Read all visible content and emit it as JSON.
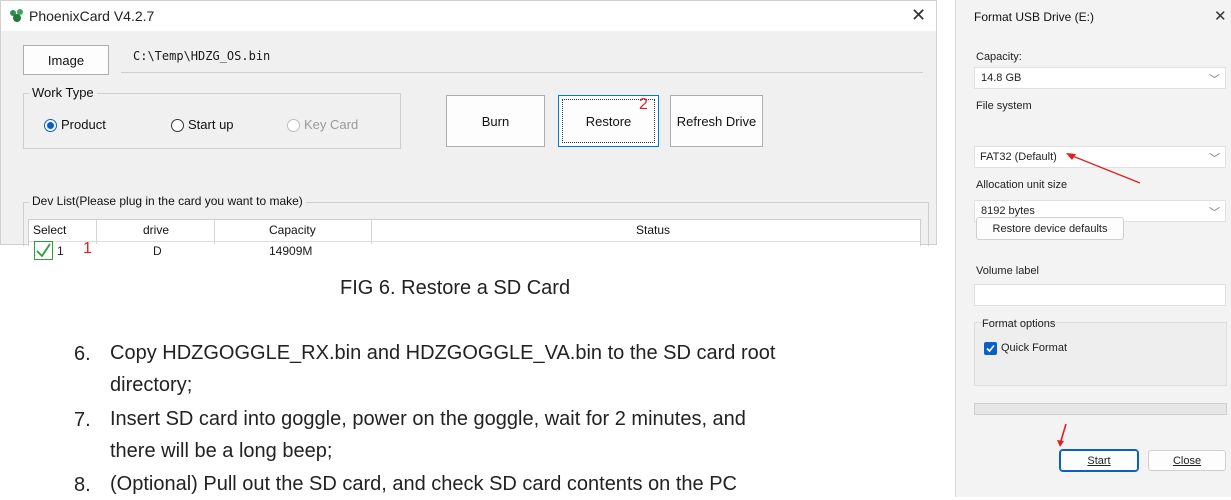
{
  "phoenix": {
    "title": "PhoenixCard V4.2.7",
    "close_glyph": "✕",
    "image_button": "Image",
    "image_path": "C:\\Temp\\HDZG_OS.bin",
    "work_type": {
      "legend": "Work Type",
      "options": [
        "Product",
        "Start up",
        "Key Card"
      ]
    },
    "buttons": {
      "burn": "Burn",
      "restore": "Restore",
      "refresh": "Refresh Drive"
    },
    "dev_list": {
      "legend": "Dev List(Please plug in the card you want to make)",
      "columns": [
        "Select",
        "drive",
        "Capacity",
        "Status"
      ],
      "rows": [
        {
          "index": "1",
          "drive": "D",
          "capacity": "14909M",
          "status": ""
        }
      ]
    },
    "annotations": {
      "restore": "2",
      "row": "1"
    }
  },
  "caption": "FIG 6. Restore a SD Card",
  "steps": [
    {
      "num": "6.",
      "line1": "Copy HDZGOGGLE_RX.bin and HDZGOGGLE_VA.bin to the SD card root",
      "line2": "directory;"
    },
    {
      "num": "7.",
      "line1": "Insert SD card into goggle, power on the goggle, wait for 2 minutes, and",
      "line2": "there will be a long beep;"
    },
    {
      "num": "8.",
      "line1": "(Optional) Pull out the SD card, and check SD card contents on the PC"
    }
  ],
  "format_dialog": {
    "title": "Format USB Drive (E:)",
    "close_glyph": "✕",
    "capacity": {
      "label": "Capacity:",
      "value": "14.8 GB"
    },
    "file_system": {
      "label": "File system",
      "value": "FAT32 (Default)"
    },
    "allocation": {
      "label": "Allocation unit size",
      "value": "8192 bytes"
    },
    "restore_defaults": "Restore device defaults",
    "volume_label": {
      "label": "Volume label",
      "value": ""
    },
    "format_options": {
      "legend": "Format options",
      "quick_format": "Quick Format"
    },
    "start": "Start",
    "close": "Close"
  },
  "colors": {
    "accent": "#0a5fc4",
    "annotation": "#e02020",
    "check": "#2e9e3a"
  }
}
